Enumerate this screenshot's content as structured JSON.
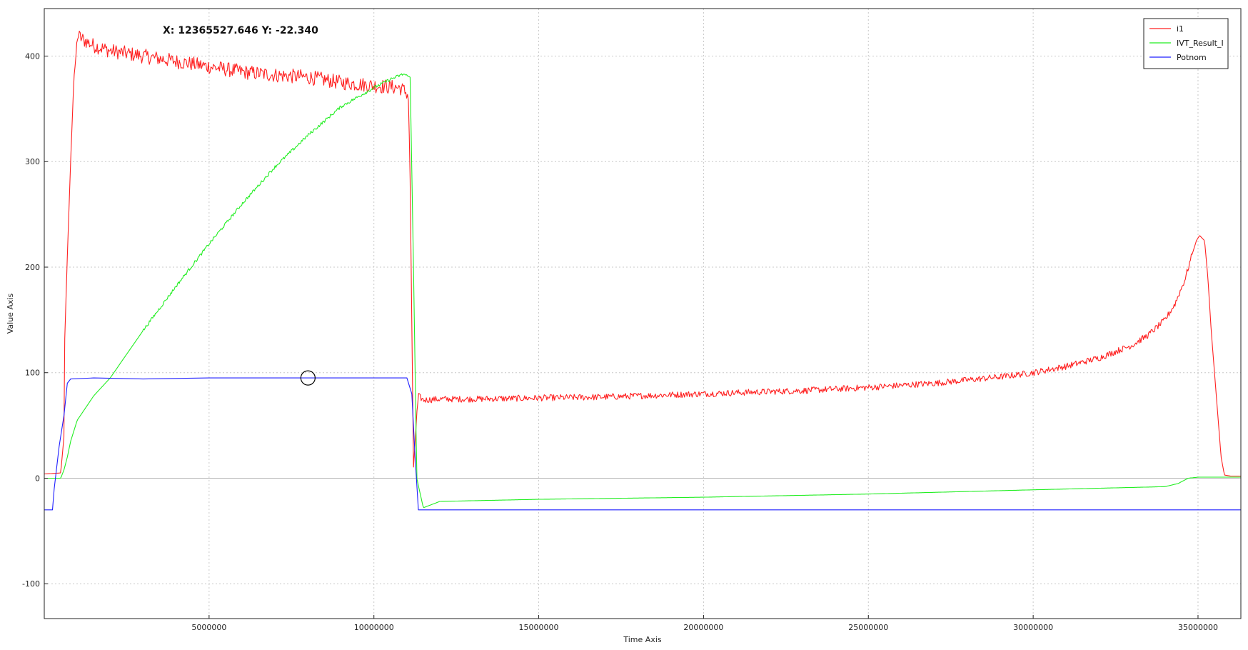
{
  "readout": {
    "label": "X: 12365527.646 Y: -22.340"
  },
  "chart_data": {
    "type": "line",
    "title": "",
    "xlabel": "Time Axis",
    "ylabel": "Value Axis",
    "xlim": [
      0,
      36300000
    ],
    "ylim": [
      -133,
      445
    ],
    "x_ticks": [
      5000000,
      10000000,
      15000000,
      20000000,
      25000000,
      30000000,
      35000000
    ],
    "x_tick_labels": [
      "5000000",
      "10000000",
      "15000000",
      "20000000",
      "25000000",
      "30000000",
      "35000000"
    ],
    "y_ticks": [
      -100,
      0,
      100,
      200,
      300,
      400
    ],
    "y_tick_labels": [
      "-100",
      "0",
      "100",
      "200",
      "300",
      "400"
    ],
    "grid": true,
    "legend_position": "top-right",
    "cursor_marker": {
      "x": 8000000,
      "y": 95
    },
    "series": [
      {
        "name": "i1",
        "color": "#ff2020",
        "noisy": true,
        "x": [
          0,
          500000,
          600000,
          620000,
          700000,
          800000,
          900000,
          950000,
          1000000,
          1200000,
          1500000,
          2000000,
          3000000,
          4000000,
          5000000,
          6000000,
          7000000,
          8000000,
          9000000,
          10000000,
          10800000,
          11000000,
          11050000,
          11100000,
          11200000,
          11300000,
          11350000,
          11500000,
          12000000,
          13000000,
          15000000,
          17000000,
          20000000,
          23000000,
          25000000,
          27000000,
          29000000,
          30000000,
          31000000,
          32000000,
          33000000,
          33500000,
          34000000,
          34300000,
          34600000,
          34800000,
          34950000,
          35050000,
          35200000,
          35300000,
          35400000,
          35500000,
          35600000,
          35700000,
          35800000,
          36000000,
          36300000
        ],
        "y": [
          4,
          5,
          40,
          130,
          210,
          300,
          380,
          395,
          420,
          415,
          410,
          405,
          400,
          395,
          390,
          385,
          382,
          380,
          375,
          372,
          370,
          365,
          360,
          280,
          10,
          60,
          78,
          74,
          75,
          75,
          76,
          77,
          80,
          83,
          86,
          90,
          96,
          100,
          106,
          114,
          126,
          136,
          150,
          165,
          188,
          210,
          225,
          230,
          225,
          190,
          140,
          100,
          60,
          20,
          3,
          2,
          2
        ]
      },
      {
        "name": "IVT_Result_I",
        "color": "#22ee22",
        "noisy": true,
        "x": [
          0,
          500000,
          600000,
          700000,
          800000,
          1000000,
          1500000,
          2000000,
          3000000,
          4000000,
          5000000,
          6000000,
          7000000,
          8000000,
          9000000,
          10000000,
          10500000,
          10900000,
          11100000,
          11200000,
          11300000,
          11500000,
          12000000,
          15000000,
          20000000,
          25000000,
          30000000,
          34000000,
          34400000,
          34700000,
          35000000,
          36300000
        ],
        "y": [
          0,
          0,
          8,
          20,
          35,
          55,
          78,
          95,
          140,
          182,
          222,
          260,
          295,
          325,
          352,
          370,
          378,
          383,
          380,
          200,
          0,
          -28,
          -22,
          -20,
          -18,
          -15,
          -11,
          -8,
          -5,
          0,
          1,
          1
        ]
      },
      {
        "name": "Potnom",
        "color": "#1f1fff",
        "noisy": false,
        "x": [
          0,
          250000,
          300000,
          450000,
          600000,
          700000,
          800000,
          1500000,
          3000000,
          5000000,
          8000000,
          10000000,
          11000000,
          11150000,
          11250000,
          11350000,
          36300000
        ],
        "y": [
          -30,
          -30,
          -10,
          30,
          60,
          90,
          94,
          95,
          94,
          95,
          95,
          95,
          95,
          80,
          20,
          -30,
          -30
        ]
      }
    ]
  }
}
